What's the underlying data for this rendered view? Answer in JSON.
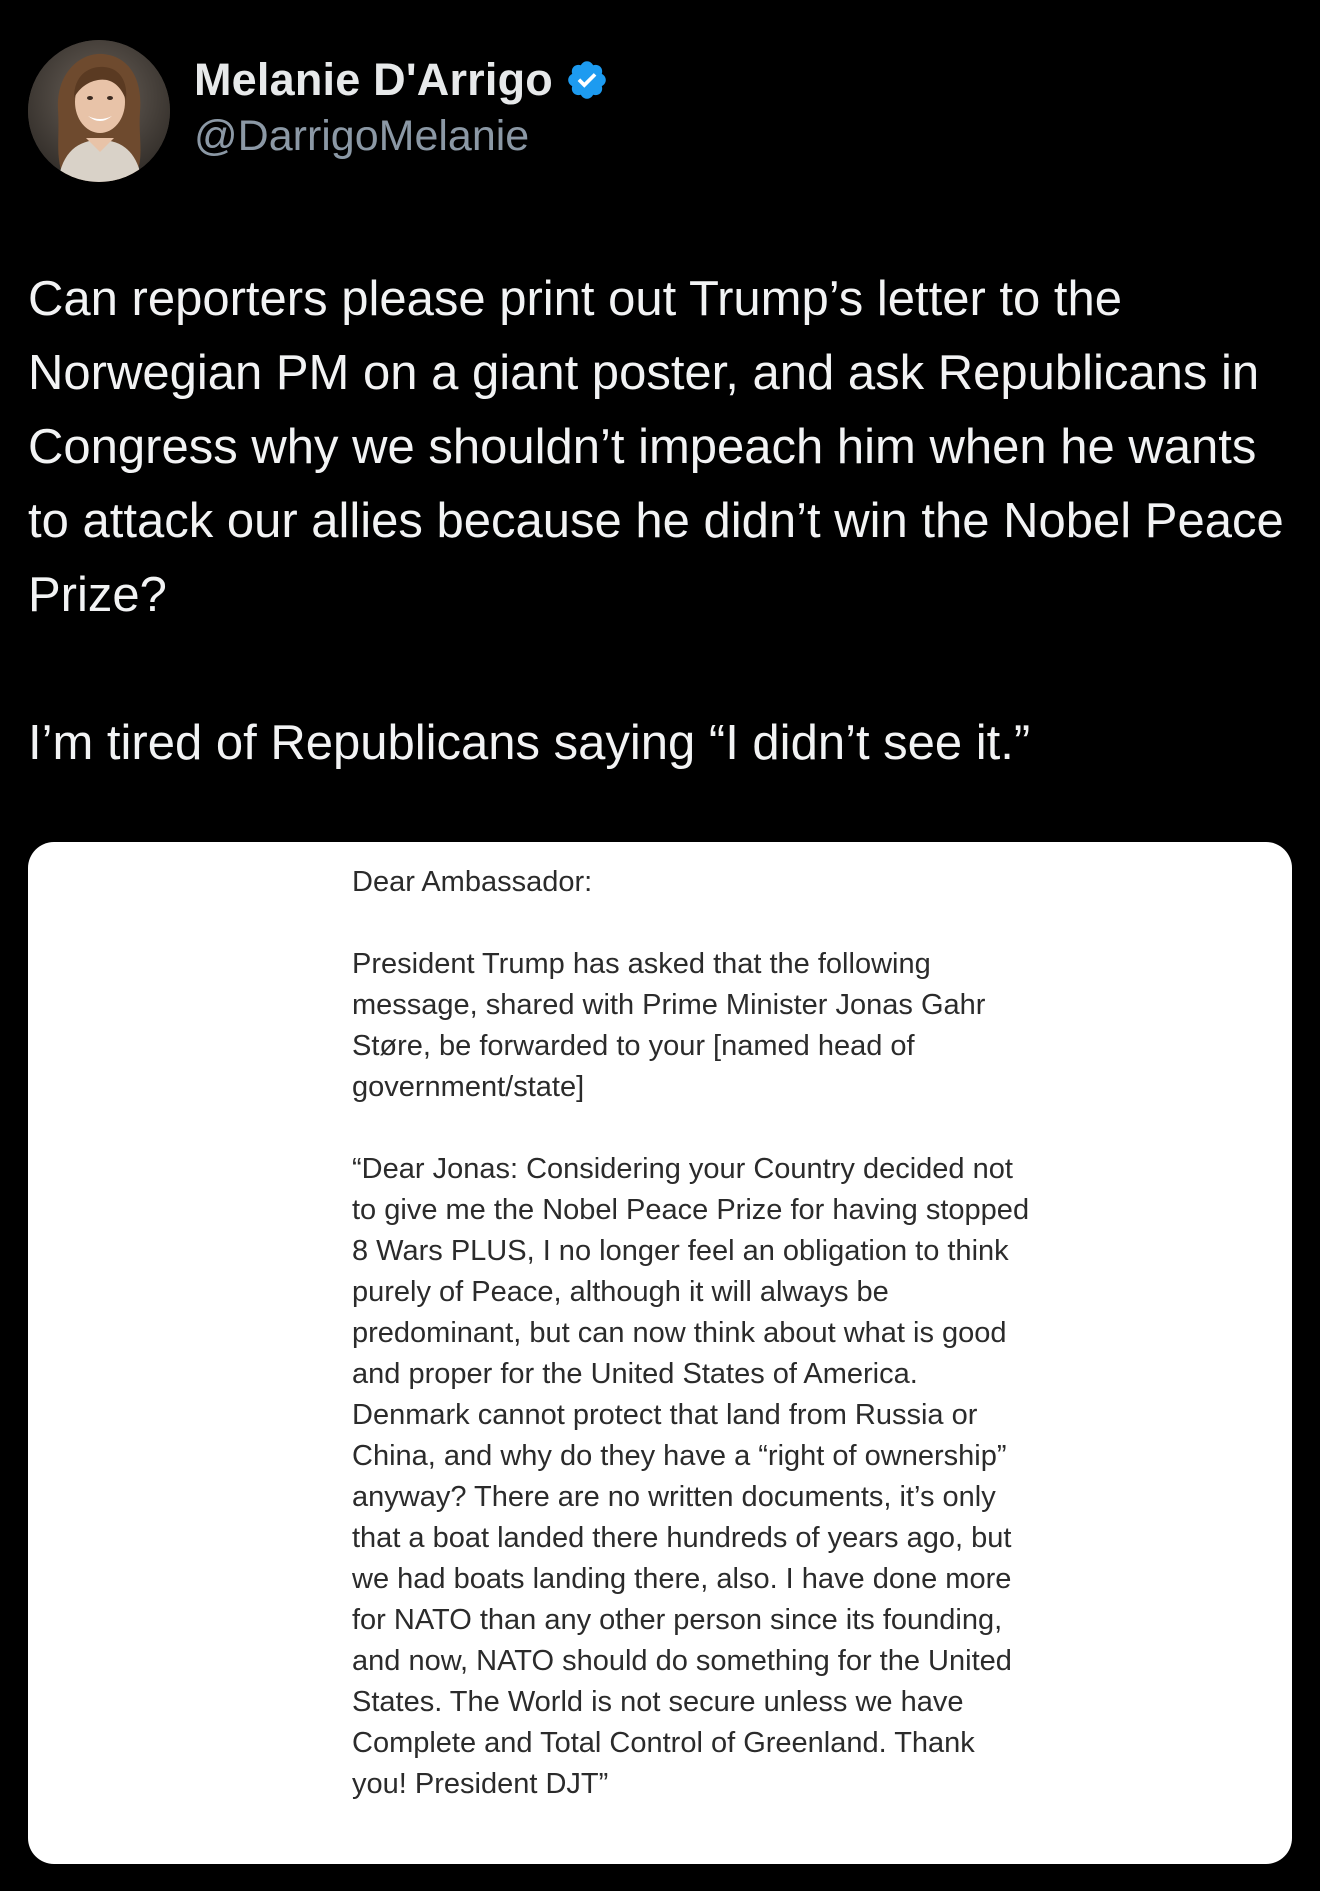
{
  "author": {
    "display_name": "Melanie D'Arrigo",
    "handle": "@DarrigoMelanie",
    "verified": true,
    "avatar_icon": "avatar-photo"
  },
  "tweet": {
    "paragraphs": [
      "Can reporters please print out Trump’s letter to the Norwegian PM on a giant poster, and ask Republicans in Congress why we shouldn’t impeach him when he wants to attack our allies because he didn’t win the Nobel Peace Prize?",
      "I’m tired of Republicans saying “I didn’t see it.”"
    ]
  },
  "media": {
    "letter": {
      "greeting": "Dear Ambassador:",
      "intro": "President Trump has asked that the following message, shared with Prime Minister Jonas Gahr Støre, be forwarded to your [named head of government/state]",
      "body": "“Dear Jonas: Considering your Country decided not to give me the Nobel Peace Prize for having stopped 8 Wars PLUS, I no longer feel an obligation to think purely of Peace, although it will always be predominant, but can now think about what is good and proper for the United States of America. Denmark cannot protect that land from Russia or China, and why do they have a “right of ownership” anyway? There are no written documents, it’s only that a boat landed there hundreds of years ago, but we had boats landing there, also. I have done more for NATO than any other person since its founding, and now, NATO should do something for the United States. The World is not secure unless we have Complete and Total Control of Greenland. Thank you! President DJT”"
    }
  },
  "colors": {
    "background": "#000000",
    "text_primary": "#e7e9ea",
    "text_secondary": "#8b98a5",
    "verified_blue": "#1d9bf0",
    "card_background": "#ffffff",
    "letter_text": "#2b2b2b"
  }
}
